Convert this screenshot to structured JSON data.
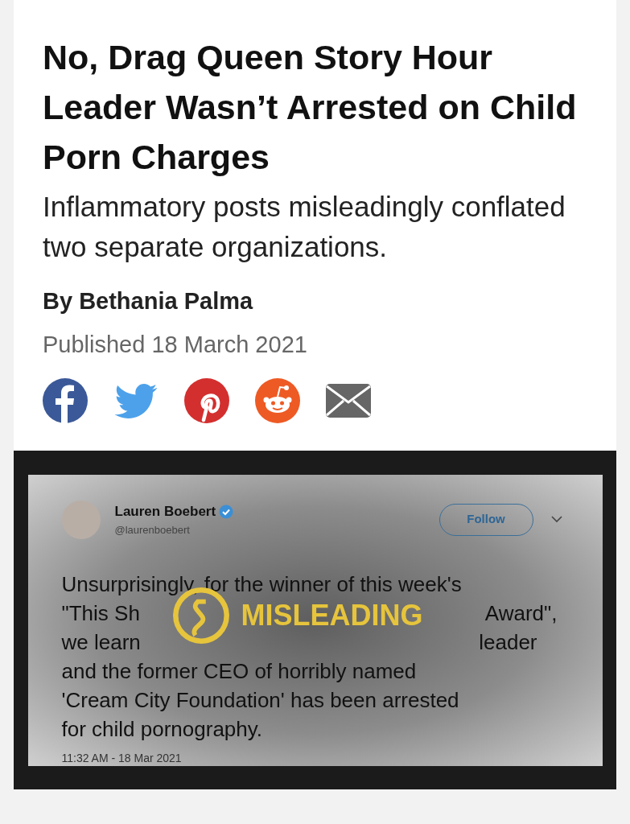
{
  "article": {
    "headline": "No, Drag Queen Story Hour Leader Wasn’t Arrested on Child Porn Charges",
    "subheadline": "Inflammatory posts misleadingly conflated two separate organizations.",
    "byline": "By Bethania Palma",
    "published": "Published 18 March 2021"
  },
  "share_buttons": [
    {
      "kind": "facebook"
    },
    {
      "kind": "twitter"
    },
    {
      "kind": "pinterest"
    },
    {
      "kind": "reddit"
    },
    {
      "kind": "email"
    }
  ],
  "tweet": {
    "name": "Lauren Boebert",
    "verified": true,
    "handle": "@laurenboebert",
    "follow_label": "Follow",
    "text_lines": [
      [
        "Unsurprisingly, for the winner of this week's"
      ],
      [
        "\"This Sh",
        "Award\","
      ],
      [
        "we learn",
        "leader"
      ],
      [
        "and the former CEO of horribly named"
      ],
      [
        "'Cream City Foundation' has been arrested"
      ],
      [
        "for child pornography."
      ]
    ],
    "timestamp": "11:32 AM - 18 Mar 2021"
  },
  "rating": {
    "label": "MISLEADING"
  }
}
